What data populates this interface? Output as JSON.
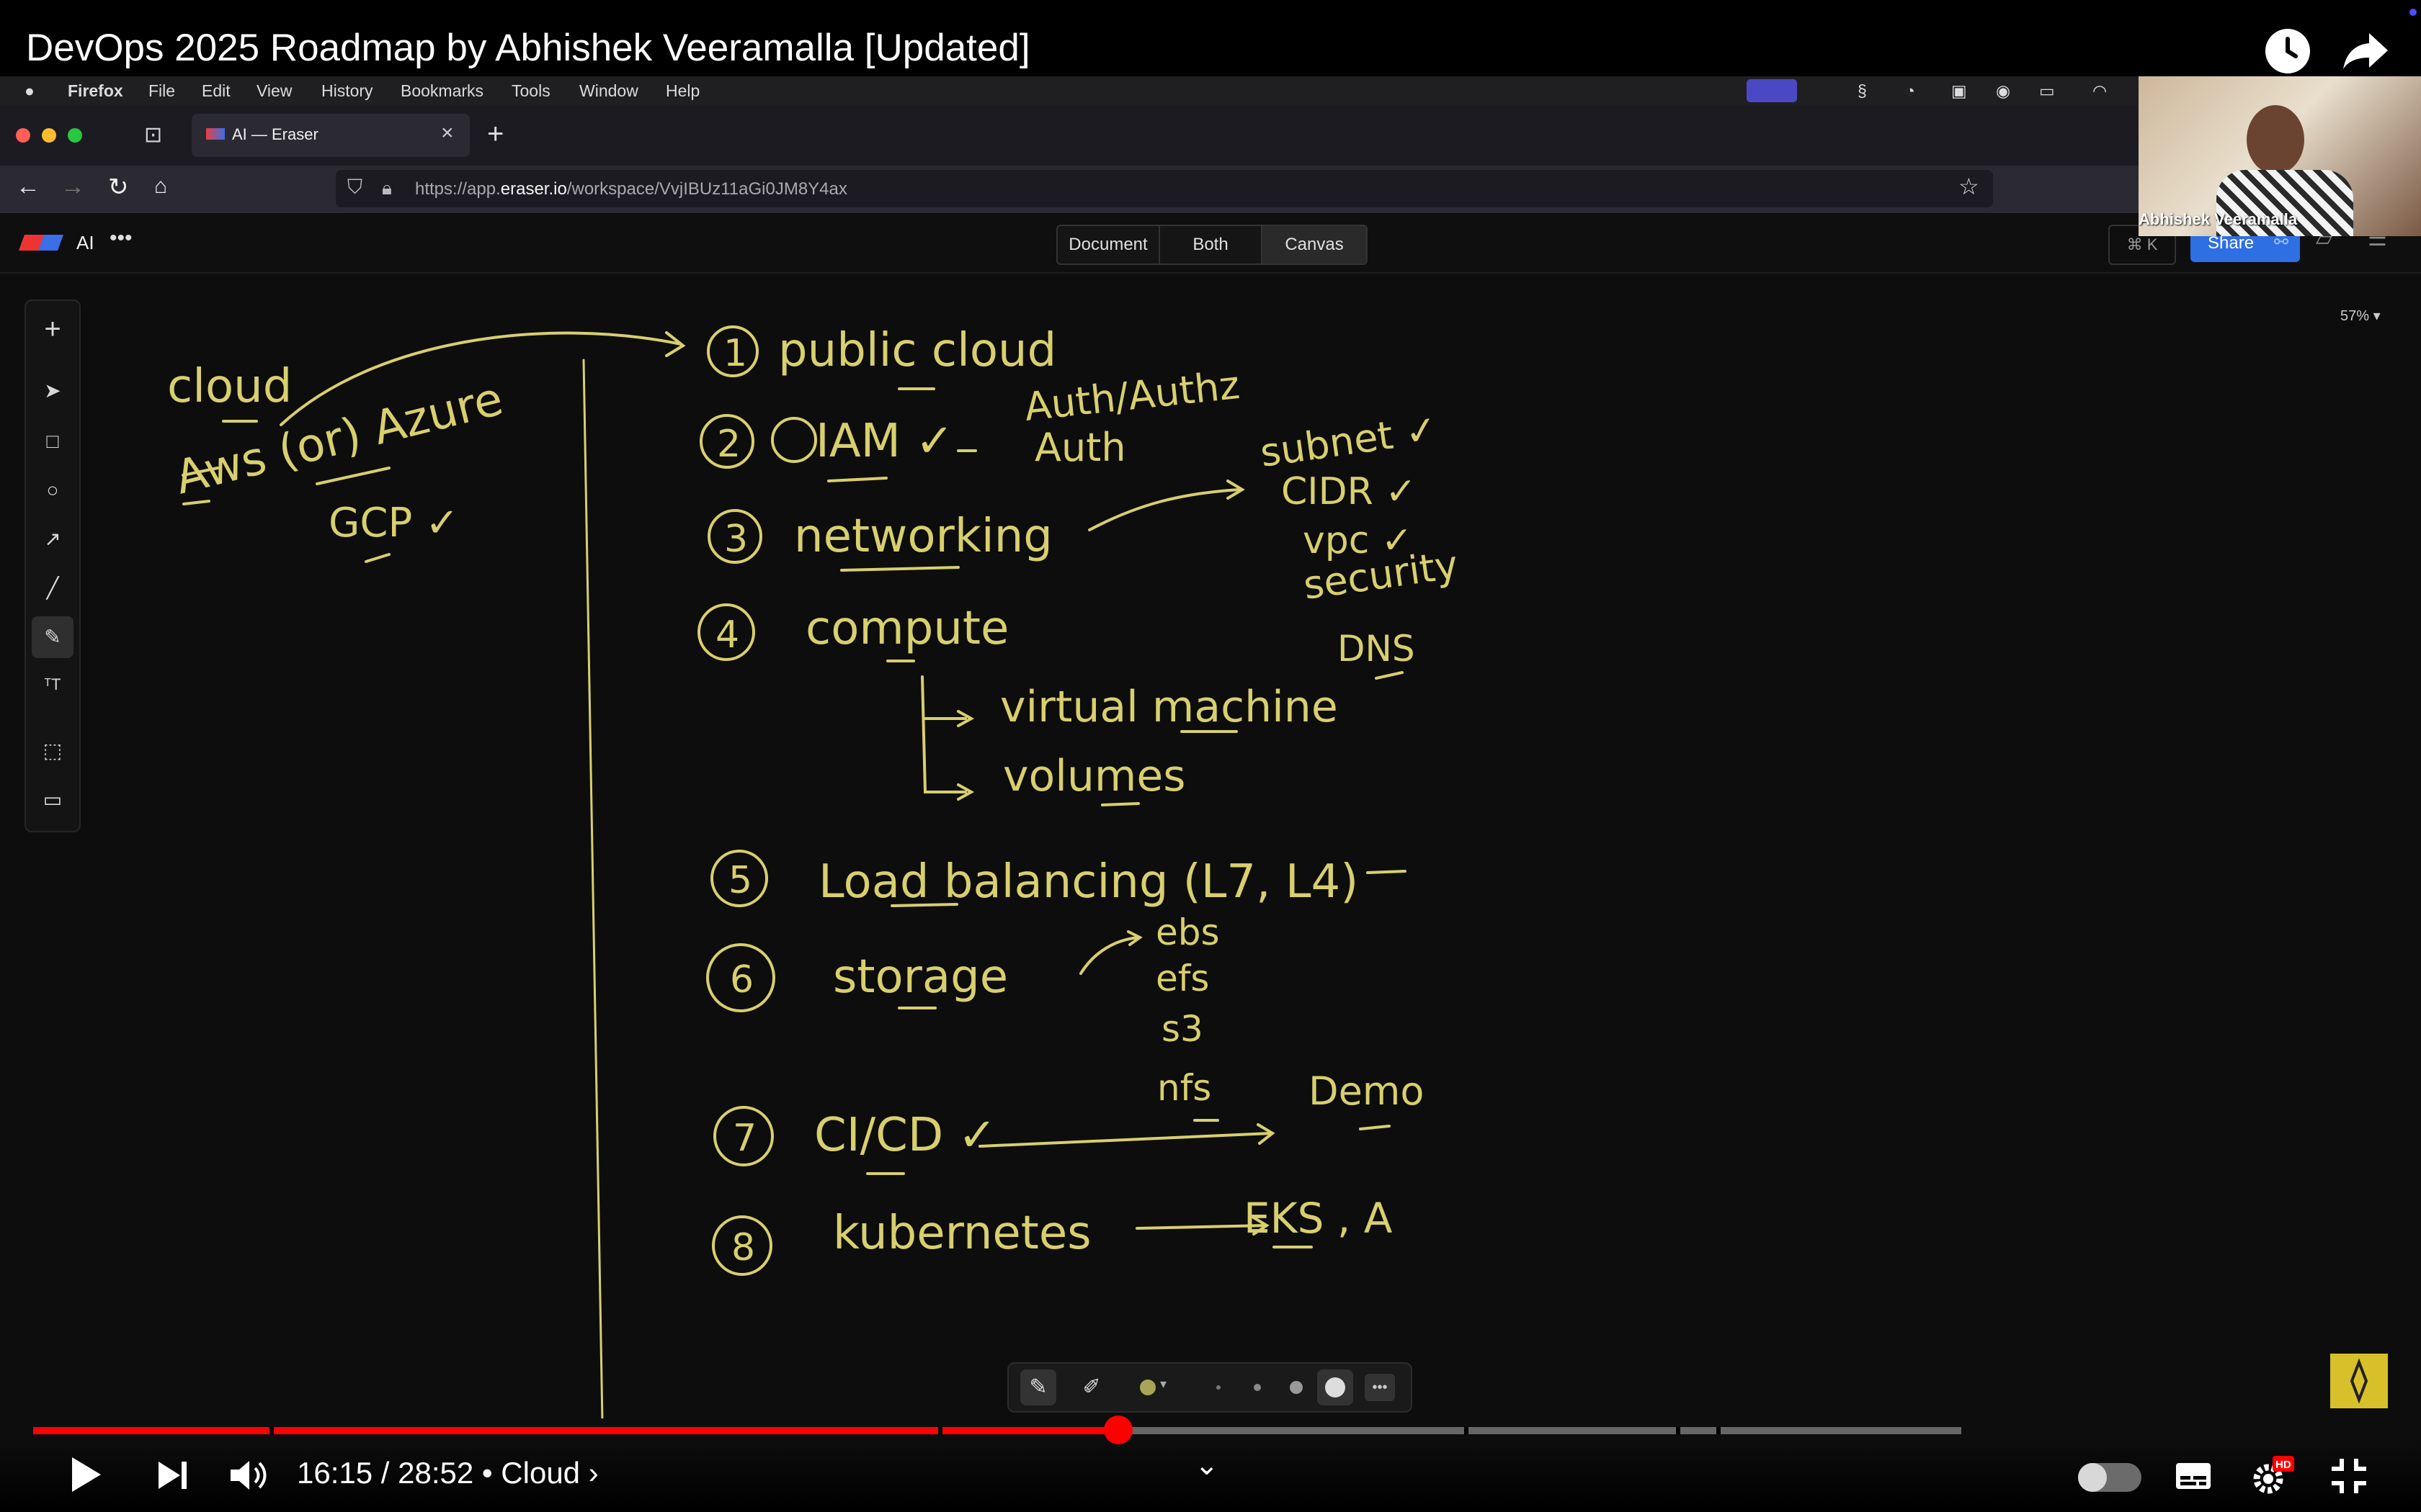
{
  "video": {
    "title": "DevOps 2025 Roadmap by Abhishek Veeramalla [Updated]",
    "time_current": "16:15",
    "time_total": "28:52",
    "time_sep": "/",
    "chapter": "Cloud",
    "chapter_chevron": "›"
  },
  "menubar": {
    "app": "Firefox",
    "items": [
      "File",
      "Edit",
      "View",
      "History",
      "Bookmarks",
      "Tools",
      "Window",
      "Help"
    ]
  },
  "browser": {
    "tab_title": "AI — Eraser",
    "url_prefix": "https://app.",
    "url_domain": "eraser.io",
    "url_path": "/workspace/VvjIBUz11aGi0JM8Y4ax"
  },
  "eraser": {
    "file_name": "AI",
    "views": [
      "Document",
      "Both",
      "Canvas"
    ],
    "shortcut": "⌘ K",
    "share_label": "Share",
    "zoom": "57%"
  },
  "webcam": {
    "name": "Abhishek Veeramalla"
  },
  "board": {
    "left": {
      "cloud": "cloud",
      "aws_azure": "Aws (or) Azure",
      "gcp": "GCP ✓"
    },
    "items": [
      {
        "num": "1",
        "text": "public cloud"
      },
      {
        "num": "2",
        "text": "IAM ✓",
        "extra1": "Auth/Authz",
        "extra2": "Auth"
      },
      {
        "num": "3",
        "text": "networking"
      },
      {
        "num": "4",
        "text": "compute"
      },
      {
        "num": "5",
        "text": "Load balancing (L7, L4)"
      },
      {
        "num": "6",
        "text": "storage"
      },
      {
        "num": "7",
        "text": "CI/CD ✓"
      },
      {
        "num": "8",
        "text": "kubernetes"
      }
    ],
    "networking_sub": [
      "subnet ✓",
      "CIDR ✓",
      "vpc ✓",
      "security",
      "DNS"
    ],
    "compute_sub": [
      "virtual machine",
      "volumes"
    ],
    "storage_sub": [
      "ebs",
      "efs",
      "s3",
      "nfs"
    ],
    "cicd_target": "Demo",
    "k8s_target": "EKS , A"
  },
  "colors": {
    "ink": "#d8cf6e",
    "progress": "#ff0000",
    "accent": "#2f6fe4"
  },
  "progress": {
    "played_fraction": 0.5629
  }
}
